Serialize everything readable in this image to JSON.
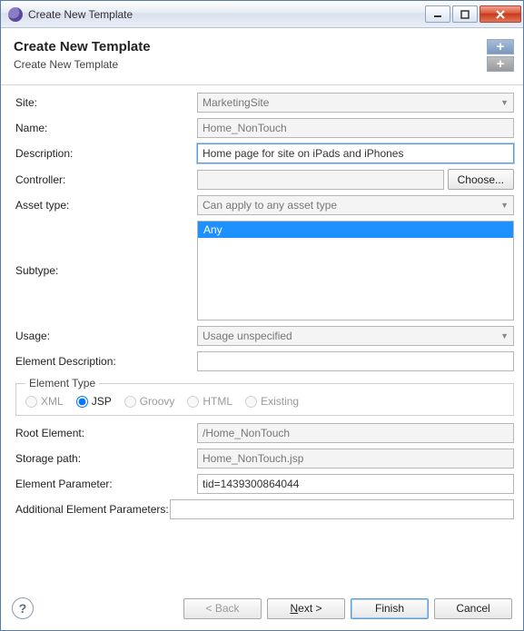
{
  "titlebar": {
    "title": "Create New Template"
  },
  "banner": {
    "heading": "Create New Template",
    "sub": "Create New Template"
  },
  "form": {
    "site": {
      "label": "Site:",
      "value": "MarketingSite"
    },
    "name": {
      "label": "Name:",
      "value": "Home_NonTouch"
    },
    "description": {
      "label": "Description:",
      "value": "Home page for site on iPads and iPhones"
    },
    "controller": {
      "label": "Controller:",
      "value": "",
      "choose": "Choose..."
    },
    "asset_type": {
      "label": "Asset type:",
      "value": "Can apply to any asset type"
    },
    "subtype": {
      "label": "Subtype:",
      "options": [
        "Any"
      ],
      "selected": "Any"
    },
    "usage": {
      "label": "Usage:",
      "value": "Usage unspecified"
    },
    "element_description": {
      "label": "Element Description:",
      "value": ""
    },
    "element_type": {
      "legend": "Element Type",
      "options": [
        "XML",
        "JSP",
        "Groovy",
        "HTML",
        "Existing"
      ],
      "selected": "JSP"
    },
    "root_element": {
      "label": "Root Element:",
      "value": "/Home_NonTouch"
    },
    "storage_path": {
      "label": "Storage path:",
      "value": "Home_NonTouch.jsp"
    },
    "element_parameter": {
      "label": "Element Parameter:",
      "value": "tid=1439300864044"
    },
    "additional_params": {
      "label": "Additional Element Parameters:",
      "value": ""
    }
  },
  "footer": {
    "back": "< Back",
    "next": "Next >",
    "finish": "Finish",
    "cancel": "Cancel"
  }
}
